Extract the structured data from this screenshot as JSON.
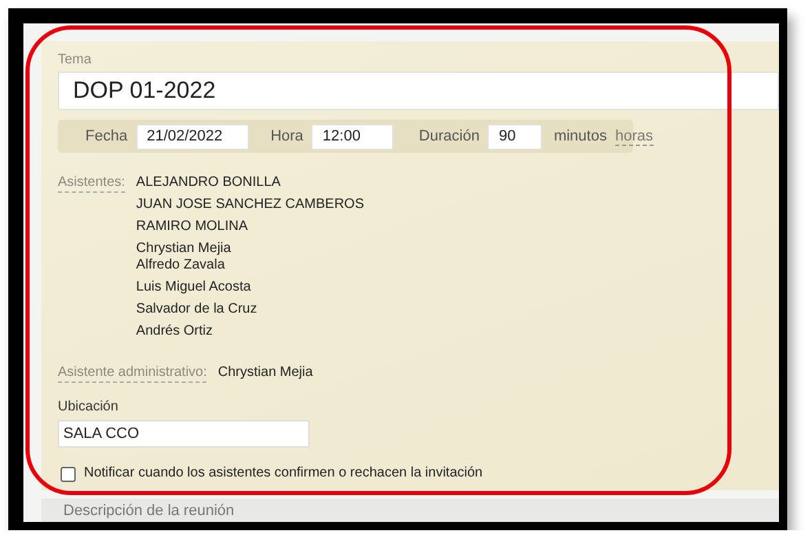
{
  "topic": {
    "label": "Tema",
    "value": "DOP 01-2022"
  },
  "schedule": {
    "date_label": "Fecha",
    "date": "21/02/2022",
    "time_label": "Hora",
    "time": "12:00",
    "duration_label": "Duración",
    "duration": "90",
    "unit_label": "minutos",
    "unit_link": "horas"
  },
  "attendees": {
    "label": "Asistentes:",
    "entries": [
      {
        "names": [
          "ALEJANDRO BONILLA"
        ]
      },
      {
        "names": [
          "JUAN JOSE SANCHEZ CAMBEROS"
        ]
      },
      {
        "names": [
          "RAMIRO MOLINA"
        ]
      },
      {
        "names": [
          "Chrystian Mejia",
          "Alfredo Zavala"
        ]
      },
      {
        "names": [
          "Luis Miguel Acosta"
        ]
      },
      {
        "names": [
          "Salvador de la Cruz"
        ]
      },
      {
        "names": [
          "Andrés Ortiz"
        ]
      }
    ]
  },
  "assistant": {
    "label": "Asistente administrativo:",
    "value": "Chrystian Mejia"
  },
  "location": {
    "label": "Ubicación",
    "value": "SALA CCO"
  },
  "notify": {
    "label": "Notificar cuando los asistentes confirmen o rechacen la invitación",
    "checked": false
  },
  "description_section": {
    "title": "Descripción de la reunión"
  }
}
